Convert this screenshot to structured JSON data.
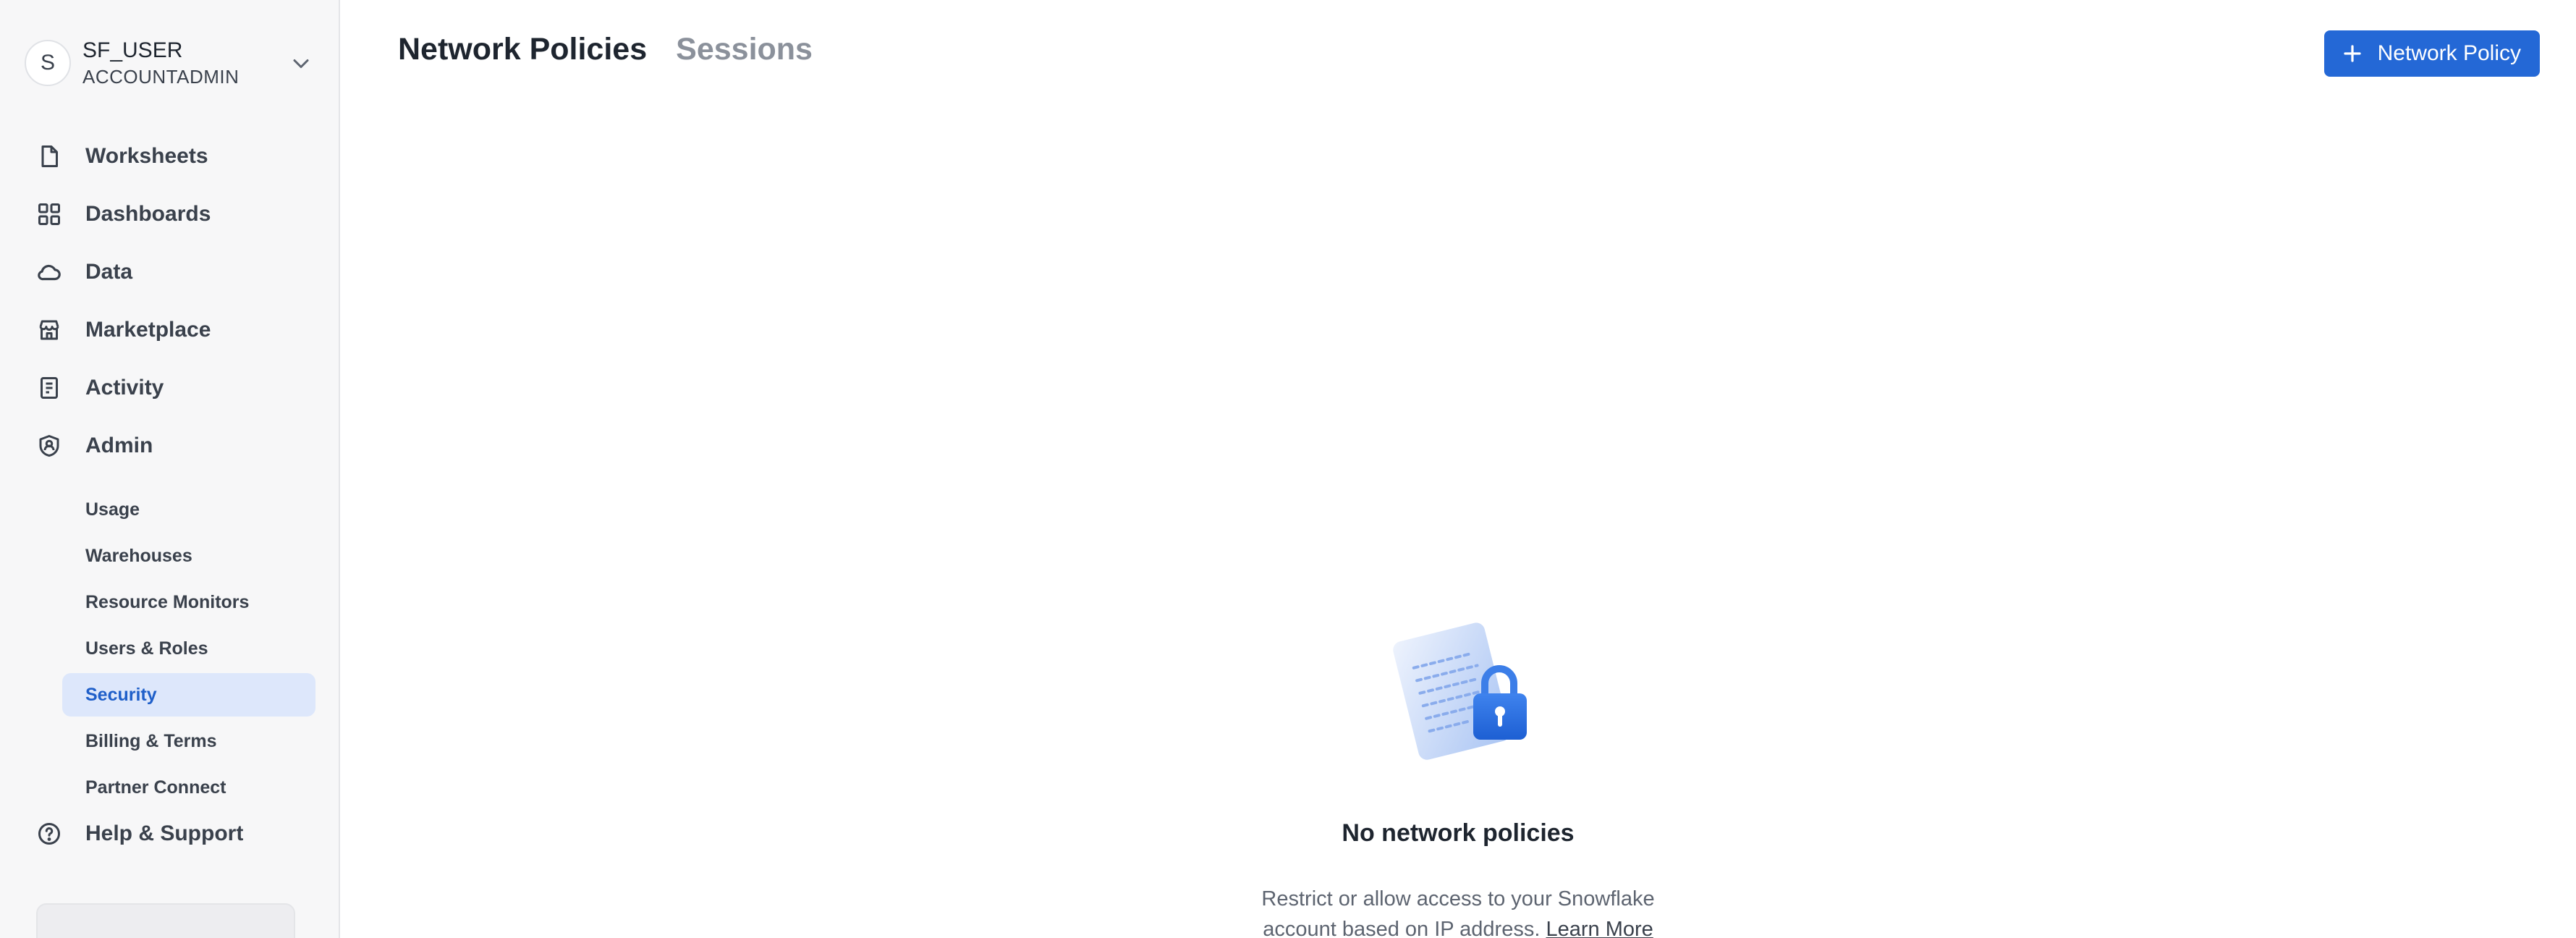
{
  "user": {
    "avatar_initial": "S",
    "name": "SF_USER",
    "role": "ACCOUNTADMIN"
  },
  "nav": {
    "items": [
      {
        "label": "Worksheets",
        "icon": "file-icon"
      },
      {
        "label": "Dashboards",
        "icon": "grid-icon"
      },
      {
        "label": "Data",
        "icon": "cloud-icon"
      },
      {
        "label": "Marketplace",
        "icon": "store-icon"
      },
      {
        "label": "Activity",
        "icon": "activity-doc-icon"
      },
      {
        "label": "Admin",
        "icon": "shield-icon"
      }
    ],
    "admin_subitems": [
      {
        "label": "Usage"
      },
      {
        "label": "Warehouses"
      },
      {
        "label": "Resource Monitors"
      },
      {
        "label": "Users & Roles"
      },
      {
        "label": "Security",
        "active": true
      },
      {
        "label": "Billing & Terms"
      },
      {
        "label": "Partner Connect"
      }
    ],
    "help": {
      "label": "Help & Support",
      "icon": "help-circle-icon"
    }
  },
  "header": {
    "tabs": [
      {
        "label": "Network Policies",
        "active": true
      },
      {
        "label": "Sessions",
        "active": false
      }
    ],
    "primary_button": "Network Policy"
  },
  "empty_state": {
    "title": "No network policies",
    "description": "Restrict or allow access to your Snowflake account based on IP address.",
    "link": "Learn More",
    "illustration": "document-lock-icon"
  },
  "colors": {
    "accent": "#2468d6",
    "active_nav_bg": "#dde7fb",
    "active_nav_text": "#1f5fc9",
    "sidebar_bg": "#f7f7f8"
  }
}
